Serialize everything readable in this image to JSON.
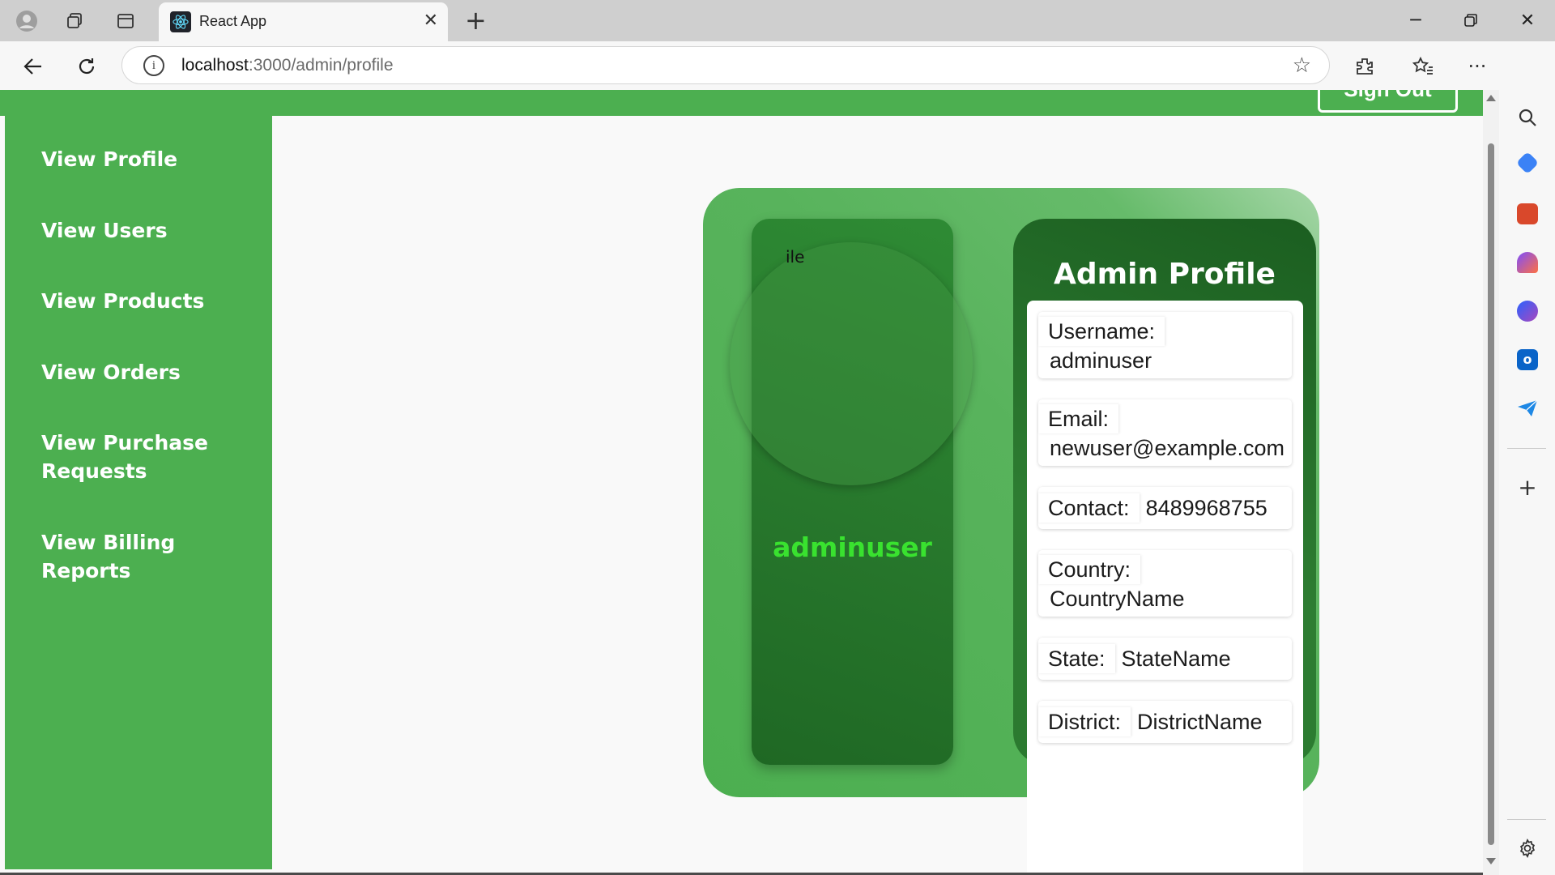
{
  "browser": {
    "tab_title": "React App",
    "url_host": "localhost",
    "url_path": ":3000/admin/profile"
  },
  "header": {
    "signout_label": "Sign Out"
  },
  "sidebar": {
    "items": [
      {
        "label": "View Profile"
      },
      {
        "label": "View Users"
      },
      {
        "label": "View Products"
      },
      {
        "label": "View Orders"
      },
      {
        "label": "View Purchase Requests"
      },
      {
        "label": "View Billing Reports"
      }
    ]
  },
  "profile": {
    "avatar_alt": "ile",
    "display_name": "adminuser",
    "title": "Admin Profile",
    "fields": [
      {
        "label": "Username:",
        "value": "adminuser"
      },
      {
        "label": "Email:",
        "value": "newuser@example.com"
      },
      {
        "label": "Contact:",
        "value": "8489968755"
      },
      {
        "label": "Country:",
        "value": "CountryName"
      },
      {
        "label": "State:",
        "value": "StateName"
      },
      {
        "label": "District:",
        "value": "DistrictName"
      }
    ]
  },
  "colors": {
    "accent": "#4caf50",
    "dark_green": "#1b5e20",
    "name_green": "#39e22f"
  }
}
